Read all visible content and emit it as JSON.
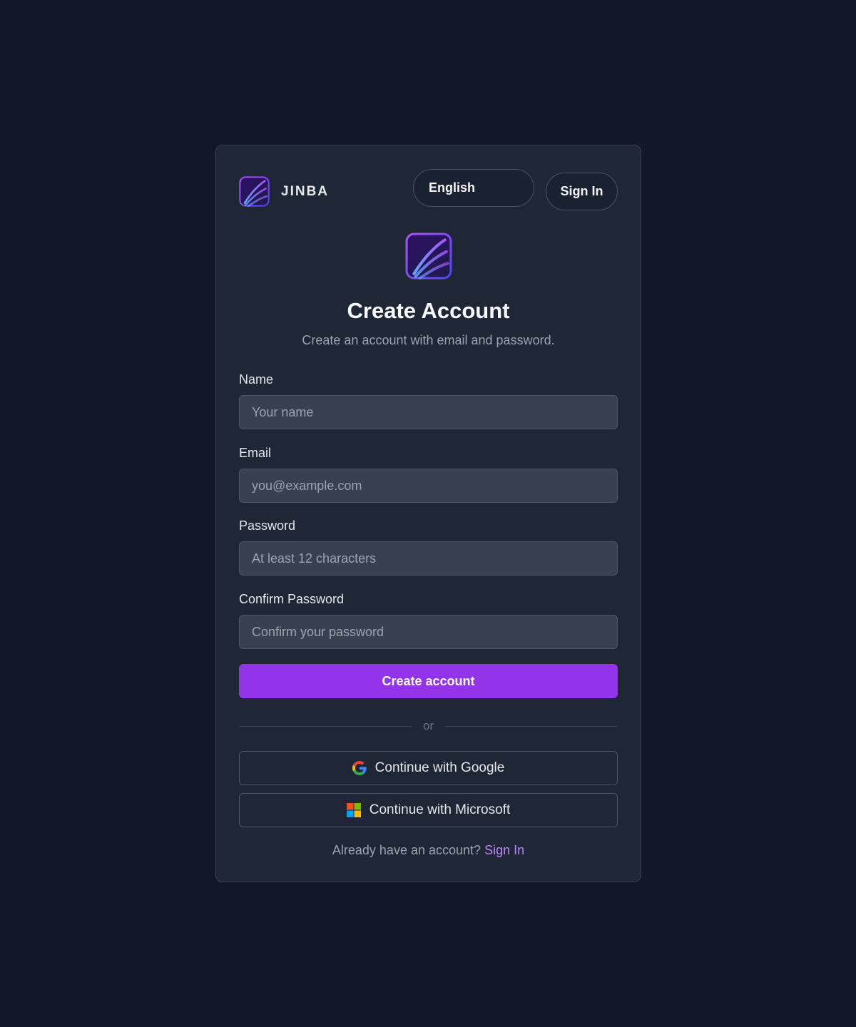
{
  "header": {
    "brand_name": "JINBA",
    "language_label": "English",
    "signin_label": "Sign In"
  },
  "main": {
    "title": "Create Account",
    "subtitle": "Create an account with email and password."
  },
  "form": {
    "name": {
      "label": "Name",
      "placeholder": "Your name",
      "value": ""
    },
    "email": {
      "label": "Email",
      "placeholder": "you@example.com",
      "value": ""
    },
    "password": {
      "label": "Password",
      "placeholder": "At least 12 characters",
      "value": ""
    },
    "confirm_password": {
      "label": "Confirm Password",
      "placeholder": "Confirm your password",
      "value": ""
    },
    "submit_label": "Create account"
  },
  "divider_label": "or",
  "oauth": {
    "google_label": "Continue with Google",
    "microsoft_label": "Continue with Microsoft"
  },
  "footer": {
    "prompt": "Already have an account?",
    "link_label": "Sign In"
  },
  "icons": {
    "brand": "jinba-logo-icon",
    "google": "google-icon",
    "microsoft": "microsoft-icon"
  },
  "colors": {
    "background": "#121828",
    "card": "#1f2737",
    "accent": "#9333ea",
    "link": "#c084fc"
  }
}
